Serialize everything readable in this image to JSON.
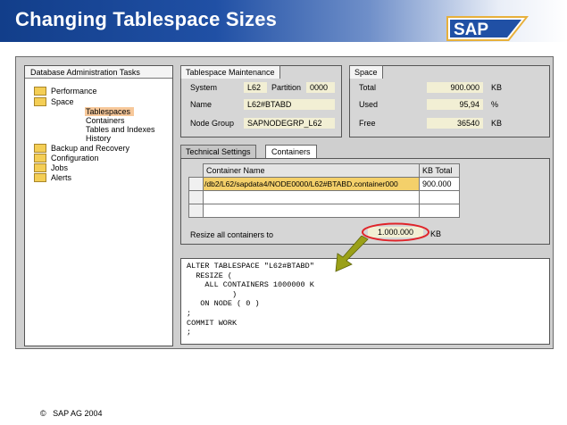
{
  "slide": {
    "title": "Changing Tablespace Sizes",
    "logo_text": "SAP",
    "copyright": "SAP AG 2004",
    "copyright_symbol": "©"
  },
  "colors": {
    "banner_dark": "#123e8a",
    "logo_gold": "#e7b03b",
    "logo_blue": "#2050a5",
    "field_bg": "#f2efd4",
    "highlight_orange": "#f7c89a",
    "arrow_olive": "#9aa018",
    "ellipse_red": "#e0242a"
  },
  "tasks_panel": {
    "title": "Database Administration Tasks",
    "items": [
      {
        "label": "Performance",
        "icon": "folder-icon"
      },
      {
        "label": "Space",
        "icon": "folder-icon"
      }
    ],
    "space_children": [
      "Tablespaces",
      "Containers",
      "Tables and Indexes",
      "History"
    ],
    "selected": "Tablespaces",
    "items_after": [
      {
        "label": "Backup and Recovery",
        "icon": "folder-icon"
      },
      {
        "label": "Configuration",
        "icon": "folder-icon"
      },
      {
        "label": "Jobs",
        "icon": "folder-icon"
      },
      {
        "label": "Alerts",
        "icon": "folder-icon"
      }
    ]
  },
  "maintenance_panel": {
    "title": "Tablespace Maintenance",
    "system_label": "System",
    "system_value": "L62",
    "partition_label": "Partition",
    "partition_value": "0000",
    "name_label": "Name",
    "name_value": "L62#BTABD",
    "nodegroup_label": "Node Group",
    "nodegroup_value": "SAPNODEGRP_L62"
  },
  "space_panel": {
    "title": "Space",
    "rows": [
      {
        "label": "Total",
        "value": "900.000",
        "unit": "KB"
      },
      {
        "label": "Used",
        "value": "95,94",
        "unit": "%"
      },
      {
        "label": "Free",
        "value": "36540",
        "unit": "KB"
      }
    ]
  },
  "tabs": [
    {
      "label": "Technical Settings",
      "active": false
    },
    {
      "label": "Containers",
      "active": true
    }
  ],
  "containers_table": {
    "headers": [
      "Container Name",
      "KB Total"
    ],
    "rows": [
      {
        "name": "/db2/L62/sapdata4/NODE0000/L62#BTABD.container000",
        "kb": "900.000"
      }
    ]
  },
  "resize": {
    "label": "Resize all containers to",
    "value": "1.000.000",
    "unit": "KB"
  },
  "sql": {
    "lines": [
      "ALTER TABLESPACE \"L62#BTABD\"",
      "  RESIZE (",
      "    ALL CONTAINERS 1000000 K",
      "          )",
      "   ON NODE ( 0 )",
      ";",
      "COMMIT WORK",
      ";"
    ]
  }
}
